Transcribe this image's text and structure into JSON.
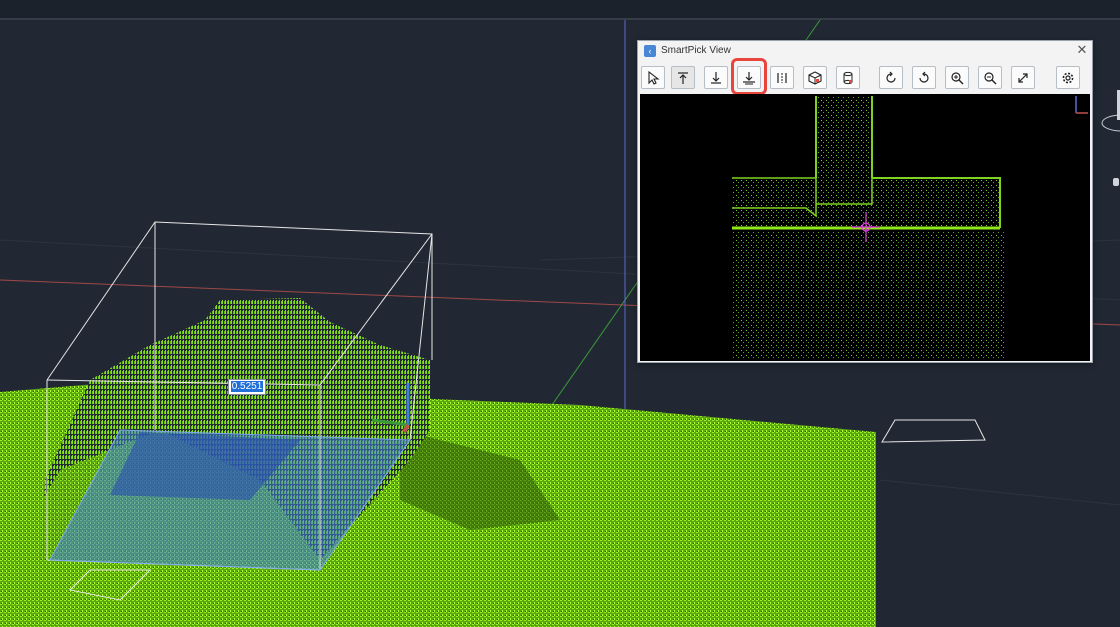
{
  "colors": {
    "background": "#212833",
    "point_cloud": "#8ee81a",
    "selection_box": "#3f7fe0",
    "highlight": "#e8453c",
    "axis_red": "#c0504d",
    "axis_green": "#3a9a3a"
  },
  "viewport": {
    "measurement_value": "0.5251"
  },
  "smartpick": {
    "title": "SmartPick View",
    "close_label": "✕",
    "app_icon": "smartpick-app-icon",
    "toolbar": [
      {
        "name": "select-tool-button",
        "icon": "cursor-arrow-icon"
      },
      {
        "name": "pick-top-button",
        "icon": "arrow-up-to-line-icon",
        "active": true
      },
      {
        "name": "pick-bottom-button",
        "icon": "arrow-down-to-line-icon"
      },
      {
        "name": "pick-ground-button",
        "icon": "arrow-down-to-ground-icon",
        "highlighted": true
      },
      {
        "name": "vertical-section-button",
        "icon": "vertical-lines-icon"
      },
      {
        "name": "view-cube-button",
        "icon": "cube-icon"
      },
      {
        "name": "cylinder-button",
        "icon": "cylinder-icon"
      },
      {
        "name": "rotate-cw-button",
        "icon": "rotate-cw-icon"
      },
      {
        "name": "rotate-ccw-button",
        "icon": "rotate-ccw-icon"
      },
      {
        "name": "zoom-in-button",
        "icon": "zoom-in-icon"
      },
      {
        "name": "zoom-out-button",
        "icon": "zoom-out-icon"
      },
      {
        "name": "expand-button",
        "icon": "expand-icon"
      },
      {
        "name": "settings-button",
        "icon": "gear-icon"
      }
    ]
  }
}
